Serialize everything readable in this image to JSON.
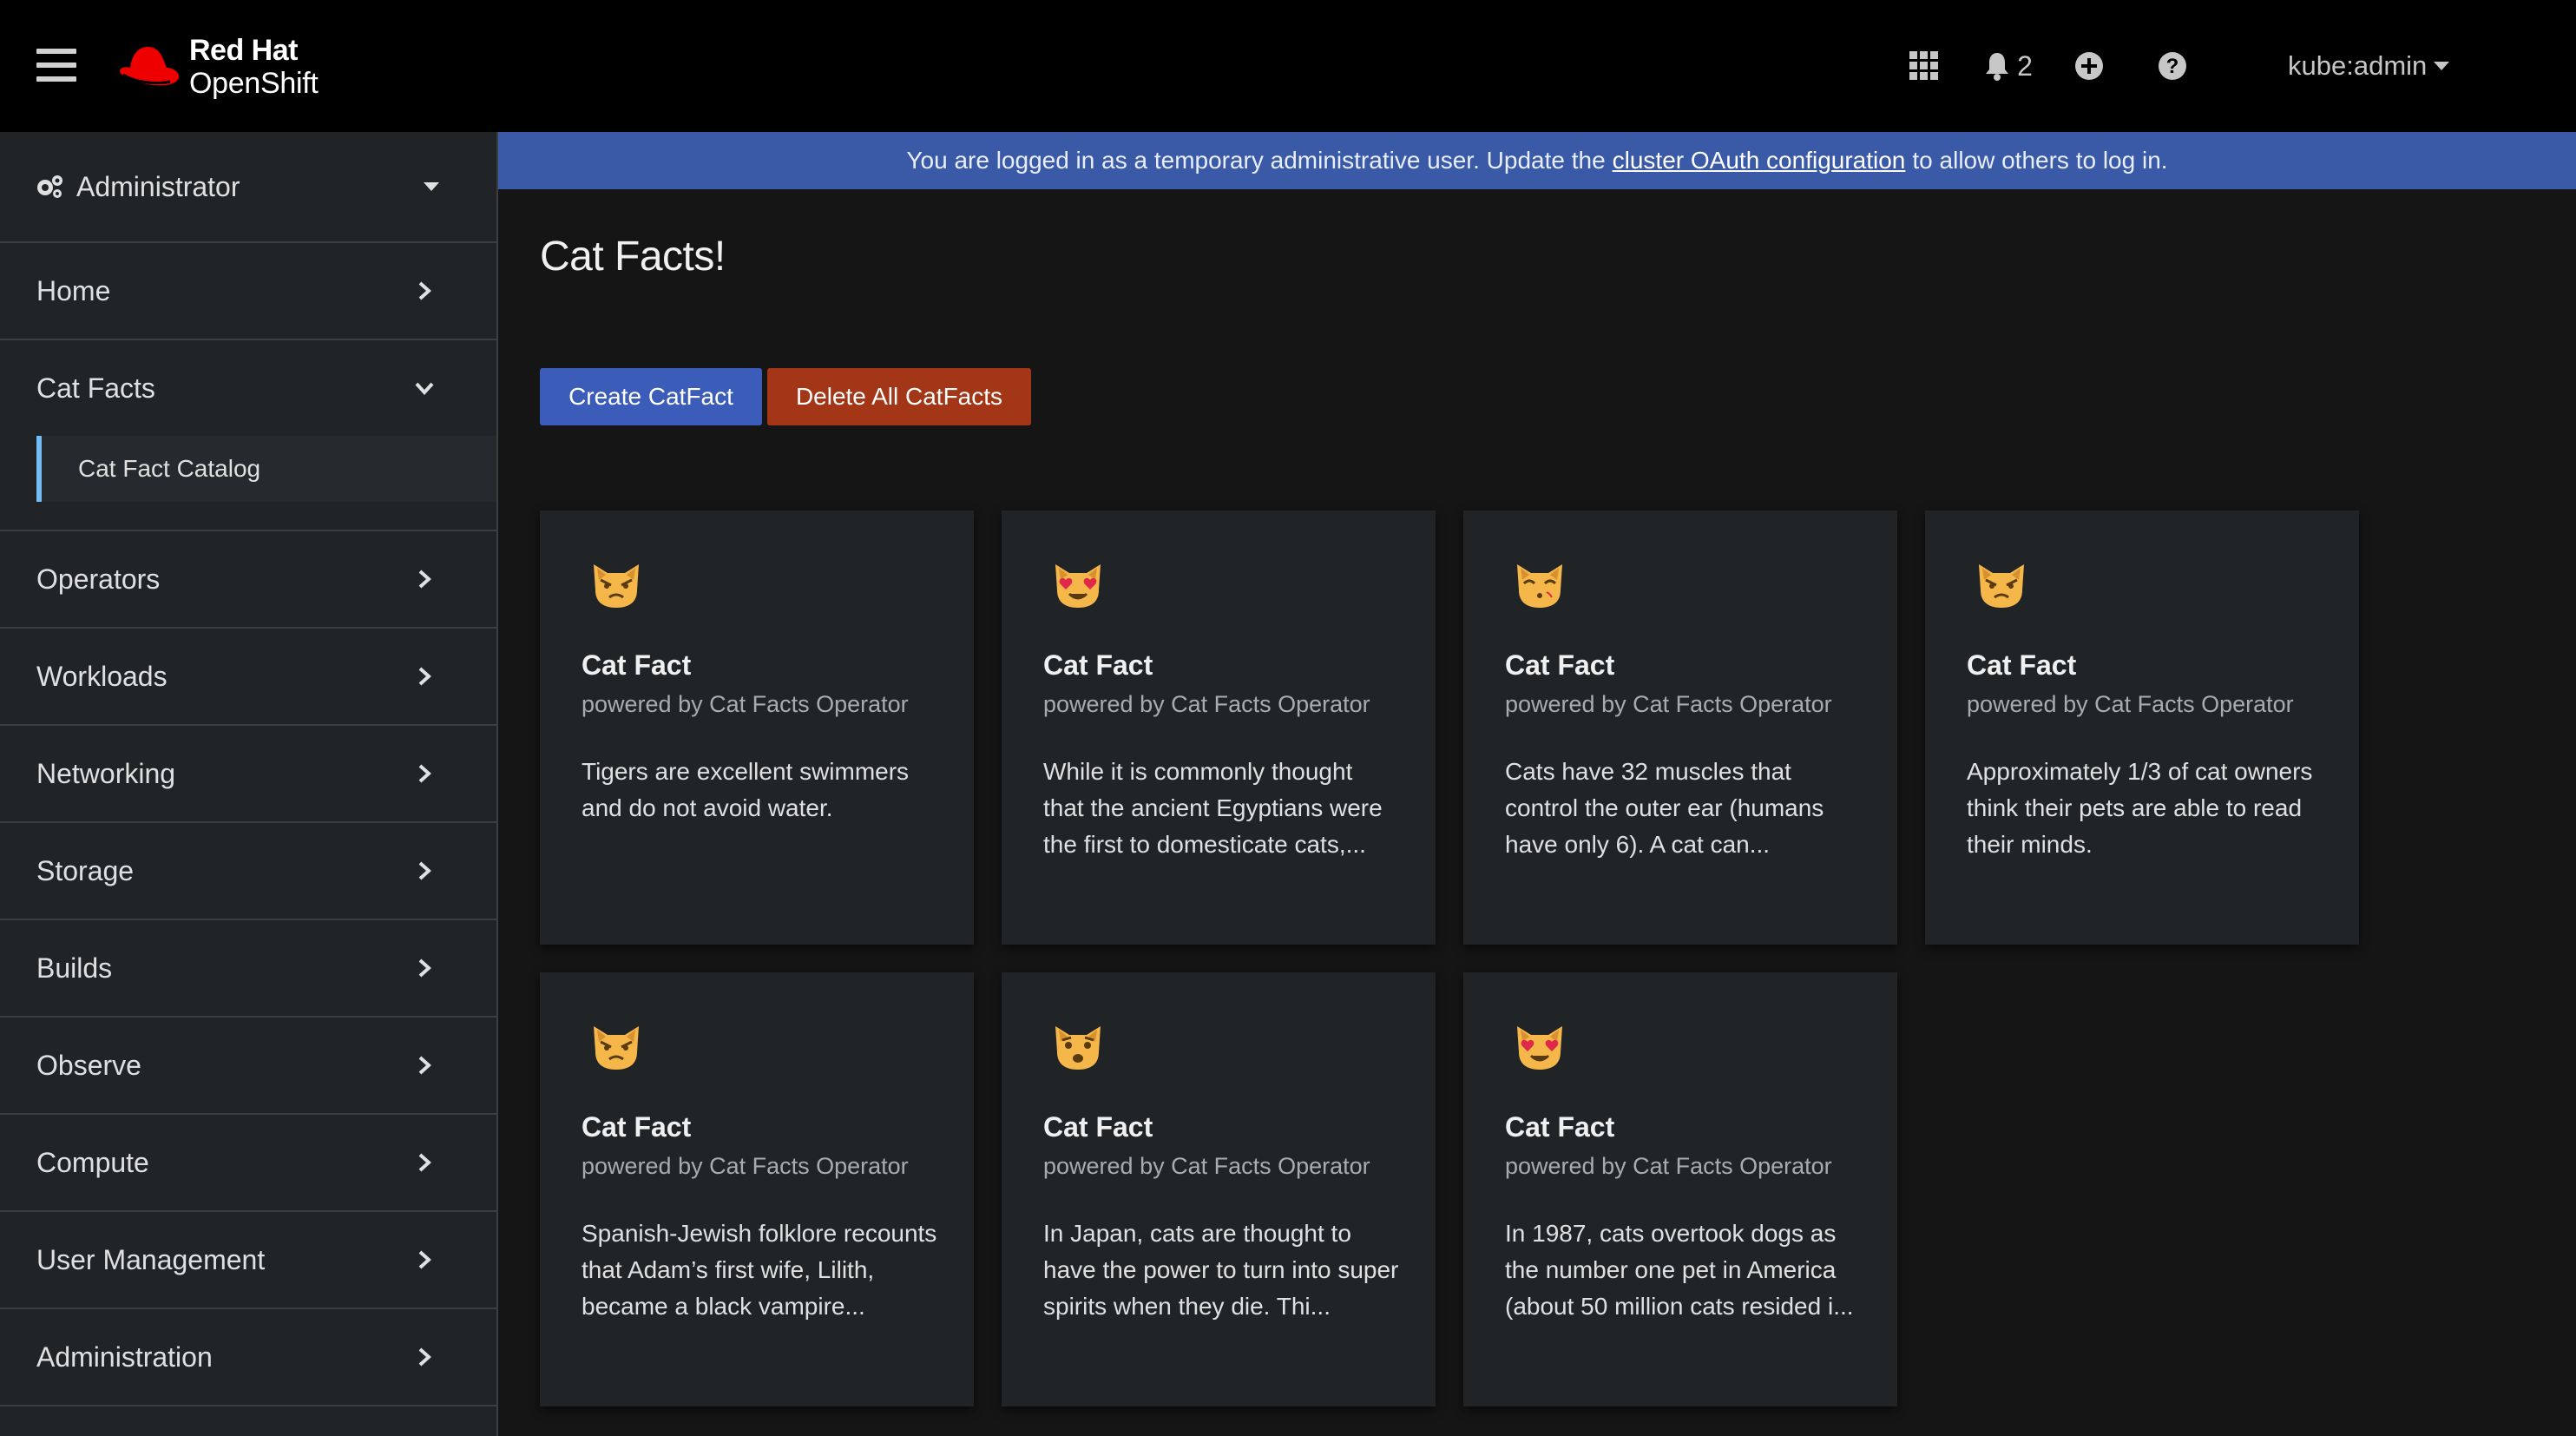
{
  "masthead": {
    "brand_line1": "Red Hat",
    "brand_line2": "OpenShift",
    "notification_count": "2",
    "user": "kube:admin"
  },
  "icons": {
    "menu": "hamburger-icon",
    "apps": "app-launcher-icon",
    "notifications": "bell-icon",
    "add": "plus-circle-icon",
    "help": "question-circle-icon"
  },
  "sidebar": {
    "perspective": "Administrator",
    "items": [
      {
        "label": "Home"
      },
      {
        "label": "Cat Facts",
        "expanded": true,
        "children": [
          {
            "label": "Cat Fact Catalog",
            "active": true
          }
        ]
      },
      {
        "label": "Operators"
      },
      {
        "label": "Workloads"
      },
      {
        "label": "Networking"
      },
      {
        "label": "Storage"
      },
      {
        "label": "Builds"
      },
      {
        "label": "Observe"
      },
      {
        "label": "Compute"
      },
      {
        "label": "User Management"
      },
      {
        "label": "Administration"
      }
    ]
  },
  "banner": {
    "text_before": "You are logged in as a temporary administrative user. Update the",
    "link": "cluster OAuth configuration",
    "text_after": "to allow others to log in."
  },
  "main": {
    "title": "Cat Facts!",
    "create_button": "Create CatFact",
    "delete_button": "Delete All CatFacts"
  },
  "cards": [
    {
      "emoji": "pouting-cat",
      "title": "Cat Fact",
      "subtitle": "powered by Cat Facts Operator",
      "body": "Tigers are excellent swimmers and do not avoid water."
    },
    {
      "emoji": "heart-eyes-cat",
      "title": "Cat Fact",
      "subtitle": "powered by Cat Facts Operator",
      "body": "While it is commonly thought that the ancient Egyptians were the first to domesticate cats,..."
    },
    {
      "emoji": "kissing-cat",
      "title": "Cat Fact",
      "subtitle": "powered by Cat Facts Operator",
      "body": "Cats have 32 muscles that control the outer ear (humans have only 6). A cat can..."
    },
    {
      "emoji": "pouting-cat",
      "title": "Cat Fact",
      "subtitle": "powered by Cat Facts Operator",
      "body": "Approximately 1/3 of cat owners think their pets are able to read their minds."
    },
    {
      "emoji": "pouting-cat",
      "title": "Cat Fact",
      "subtitle": "powered by Cat Facts Operator",
      "body": "Spanish-Jewish folklore recounts that Adam’s first wife, Lilith, became a black vampire..."
    },
    {
      "emoji": "weary-cat",
      "title": "Cat Fact",
      "subtitle": "powered by Cat Facts Operator",
      "body": "In Japan, cats are thought to have the power to turn into super spirits when they die. Thi..."
    },
    {
      "emoji": "heart-eyes-cat",
      "title": "Cat Fact",
      "subtitle": "powered by Cat Facts Operator",
      "body": "In 1987, cats overtook dogs as the number one pet in America (about 50 million cats resided i..."
    }
  ],
  "colors": {
    "masthead_bg": "#000000",
    "sidebar_bg": "#212427",
    "page_bg": "#151515",
    "banner_bg": "#3a5aa8",
    "primary_button": "#3b5cb8",
    "danger_button": "#a33617",
    "active_nav_accent": "#73bcf7",
    "cat_emoji": "#f5b74a"
  }
}
